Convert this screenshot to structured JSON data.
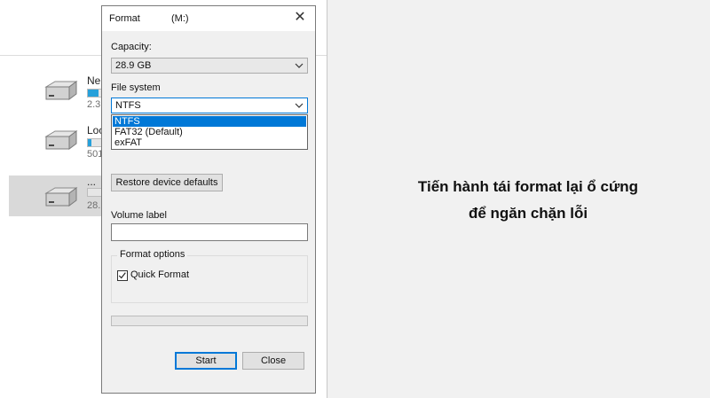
{
  "background": {
    "drives": [
      {
        "name": "Ne",
        "size": "2.3",
        "used_fraction": 0.6
      },
      {
        "name": "Loc",
        "size": "501",
        "used_fraction": 0.2
      },
      {
        "name": "...",
        "size": "28.",
        "used_fraction": 0.0
      }
    ]
  },
  "dialog": {
    "title": "Format",
    "drive_label": "(M:)",
    "capacity_label": "Capacity:",
    "capacity_value": "28.9 GB",
    "filesystem_label": "File system",
    "filesystem_value": "NTFS",
    "filesystem_options": [
      "NTFS",
      "FAT32 (Default)",
      "exFAT"
    ],
    "selected_option_index": 0,
    "restore_button": "Restore device defaults",
    "volume_label": "Volume label",
    "volume_value": "",
    "format_options_title": "Format options",
    "quick_format_label": "Quick Format",
    "quick_format_checked": true,
    "progress": 0,
    "start_button": "Start",
    "close_button": "Close"
  },
  "caption": {
    "line1": "Tiến hành tái format lại ổ cứng",
    "line2": "để ngăn chặn lỗi"
  },
  "colors": {
    "accent": "#0078d7",
    "selection_text": "#ffffff",
    "drive_bar": "#26a0da"
  }
}
